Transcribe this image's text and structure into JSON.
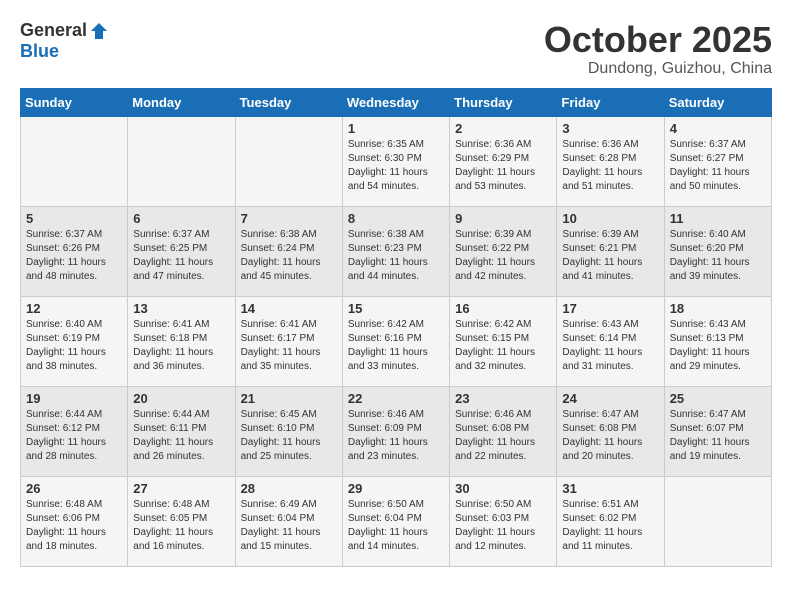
{
  "header": {
    "logo_general": "General",
    "logo_blue": "Blue",
    "month_title": "October 2025",
    "location": "Dundong, Guizhou, China"
  },
  "days_of_week": [
    "Sunday",
    "Monday",
    "Tuesday",
    "Wednesday",
    "Thursday",
    "Friday",
    "Saturday"
  ],
  "weeks": [
    [
      {
        "day": "",
        "info": ""
      },
      {
        "day": "",
        "info": ""
      },
      {
        "day": "",
        "info": ""
      },
      {
        "day": "1",
        "info": "Sunrise: 6:35 AM\nSunset: 6:30 PM\nDaylight: 11 hours\nand 54 minutes."
      },
      {
        "day": "2",
        "info": "Sunrise: 6:36 AM\nSunset: 6:29 PM\nDaylight: 11 hours\nand 53 minutes."
      },
      {
        "day": "3",
        "info": "Sunrise: 6:36 AM\nSunset: 6:28 PM\nDaylight: 11 hours\nand 51 minutes."
      },
      {
        "day": "4",
        "info": "Sunrise: 6:37 AM\nSunset: 6:27 PM\nDaylight: 11 hours\nand 50 minutes."
      }
    ],
    [
      {
        "day": "5",
        "info": "Sunrise: 6:37 AM\nSunset: 6:26 PM\nDaylight: 11 hours\nand 48 minutes."
      },
      {
        "day": "6",
        "info": "Sunrise: 6:37 AM\nSunset: 6:25 PM\nDaylight: 11 hours\nand 47 minutes."
      },
      {
        "day": "7",
        "info": "Sunrise: 6:38 AM\nSunset: 6:24 PM\nDaylight: 11 hours\nand 45 minutes."
      },
      {
        "day": "8",
        "info": "Sunrise: 6:38 AM\nSunset: 6:23 PM\nDaylight: 11 hours\nand 44 minutes."
      },
      {
        "day": "9",
        "info": "Sunrise: 6:39 AM\nSunset: 6:22 PM\nDaylight: 11 hours\nand 42 minutes."
      },
      {
        "day": "10",
        "info": "Sunrise: 6:39 AM\nSunset: 6:21 PM\nDaylight: 11 hours\nand 41 minutes."
      },
      {
        "day": "11",
        "info": "Sunrise: 6:40 AM\nSunset: 6:20 PM\nDaylight: 11 hours\nand 39 minutes."
      }
    ],
    [
      {
        "day": "12",
        "info": "Sunrise: 6:40 AM\nSunset: 6:19 PM\nDaylight: 11 hours\nand 38 minutes."
      },
      {
        "day": "13",
        "info": "Sunrise: 6:41 AM\nSunset: 6:18 PM\nDaylight: 11 hours\nand 36 minutes."
      },
      {
        "day": "14",
        "info": "Sunrise: 6:41 AM\nSunset: 6:17 PM\nDaylight: 11 hours\nand 35 minutes."
      },
      {
        "day": "15",
        "info": "Sunrise: 6:42 AM\nSunset: 6:16 PM\nDaylight: 11 hours\nand 33 minutes."
      },
      {
        "day": "16",
        "info": "Sunrise: 6:42 AM\nSunset: 6:15 PM\nDaylight: 11 hours\nand 32 minutes."
      },
      {
        "day": "17",
        "info": "Sunrise: 6:43 AM\nSunset: 6:14 PM\nDaylight: 11 hours\nand 31 minutes."
      },
      {
        "day": "18",
        "info": "Sunrise: 6:43 AM\nSunset: 6:13 PM\nDaylight: 11 hours\nand 29 minutes."
      }
    ],
    [
      {
        "day": "19",
        "info": "Sunrise: 6:44 AM\nSunset: 6:12 PM\nDaylight: 11 hours\nand 28 minutes."
      },
      {
        "day": "20",
        "info": "Sunrise: 6:44 AM\nSunset: 6:11 PM\nDaylight: 11 hours\nand 26 minutes."
      },
      {
        "day": "21",
        "info": "Sunrise: 6:45 AM\nSunset: 6:10 PM\nDaylight: 11 hours\nand 25 minutes."
      },
      {
        "day": "22",
        "info": "Sunrise: 6:46 AM\nSunset: 6:09 PM\nDaylight: 11 hours\nand 23 minutes."
      },
      {
        "day": "23",
        "info": "Sunrise: 6:46 AM\nSunset: 6:08 PM\nDaylight: 11 hours\nand 22 minutes."
      },
      {
        "day": "24",
        "info": "Sunrise: 6:47 AM\nSunset: 6:08 PM\nDaylight: 11 hours\nand 20 minutes."
      },
      {
        "day": "25",
        "info": "Sunrise: 6:47 AM\nSunset: 6:07 PM\nDaylight: 11 hours\nand 19 minutes."
      }
    ],
    [
      {
        "day": "26",
        "info": "Sunrise: 6:48 AM\nSunset: 6:06 PM\nDaylight: 11 hours\nand 18 minutes."
      },
      {
        "day": "27",
        "info": "Sunrise: 6:48 AM\nSunset: 6:05 PM\nDaylight: 11 hours\nand 16 minutes."
      },
      {
        "day": "28",
        "info": "Sunrise: 6:49 AM\nSunset: 6:04 PM\nDaylight: 11 hours\nand 15 minutes."
      },
      {
        "day": "29",
        "info": "Sunrise: 6:50 AM\nSunset: 6:04 PM\nDaylight: 11 hours\nand 14 minutes."
      },
      {
        "day": "30",
        "info": "Sunrise: 6:50 AM\nSunset: 6:03 PM\nDaylight: 11 hours\nand 12 minutes."
      },
      {
        "day": "31",
        "info": "Sunrise: 6:51 AM\nSunset: 6:02 PM\nDaylight: 11 hours\nand 11 minutes."
      },
      {
        "day": "",
        "info": ""
      }
    ]
  ]
}
